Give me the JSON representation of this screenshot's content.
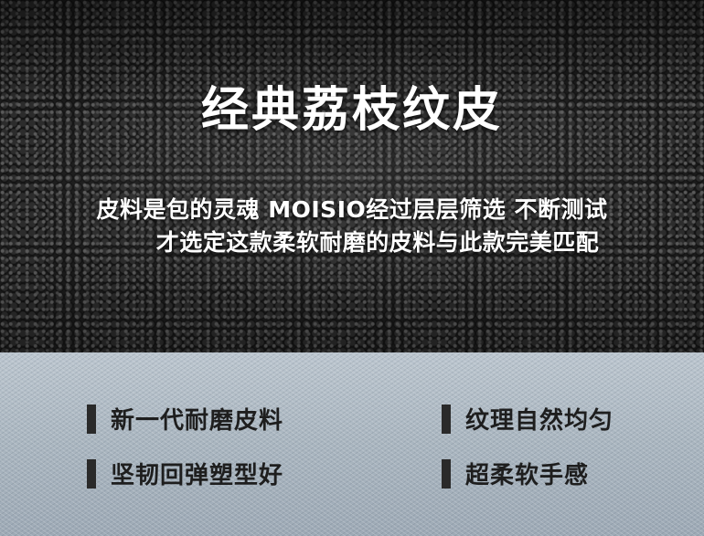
{
  "title": "经典荔枝纹皮",
  "subtitle_lines": [
    "皮料是包的灵魂 MOISIO经过层层筛选 不断测试",
    "才选定这款柔软耐磨的皮料与此款完美匹配"
  ],
  "features": [
    "新一代耐磨皮料",
    "纹理自然均匀",
    "坚韧回弹塑型好",
    "超柔软手感"
  ],
  "colors": {
    "top_background": "#1b1b1b",
    "bottom_background": "#a9b6c1",
    "title_text": "#ffffff",
    "feature_text": "#1e1e1e",
    "feature_bar": "#2a2a2a"
  }
}
